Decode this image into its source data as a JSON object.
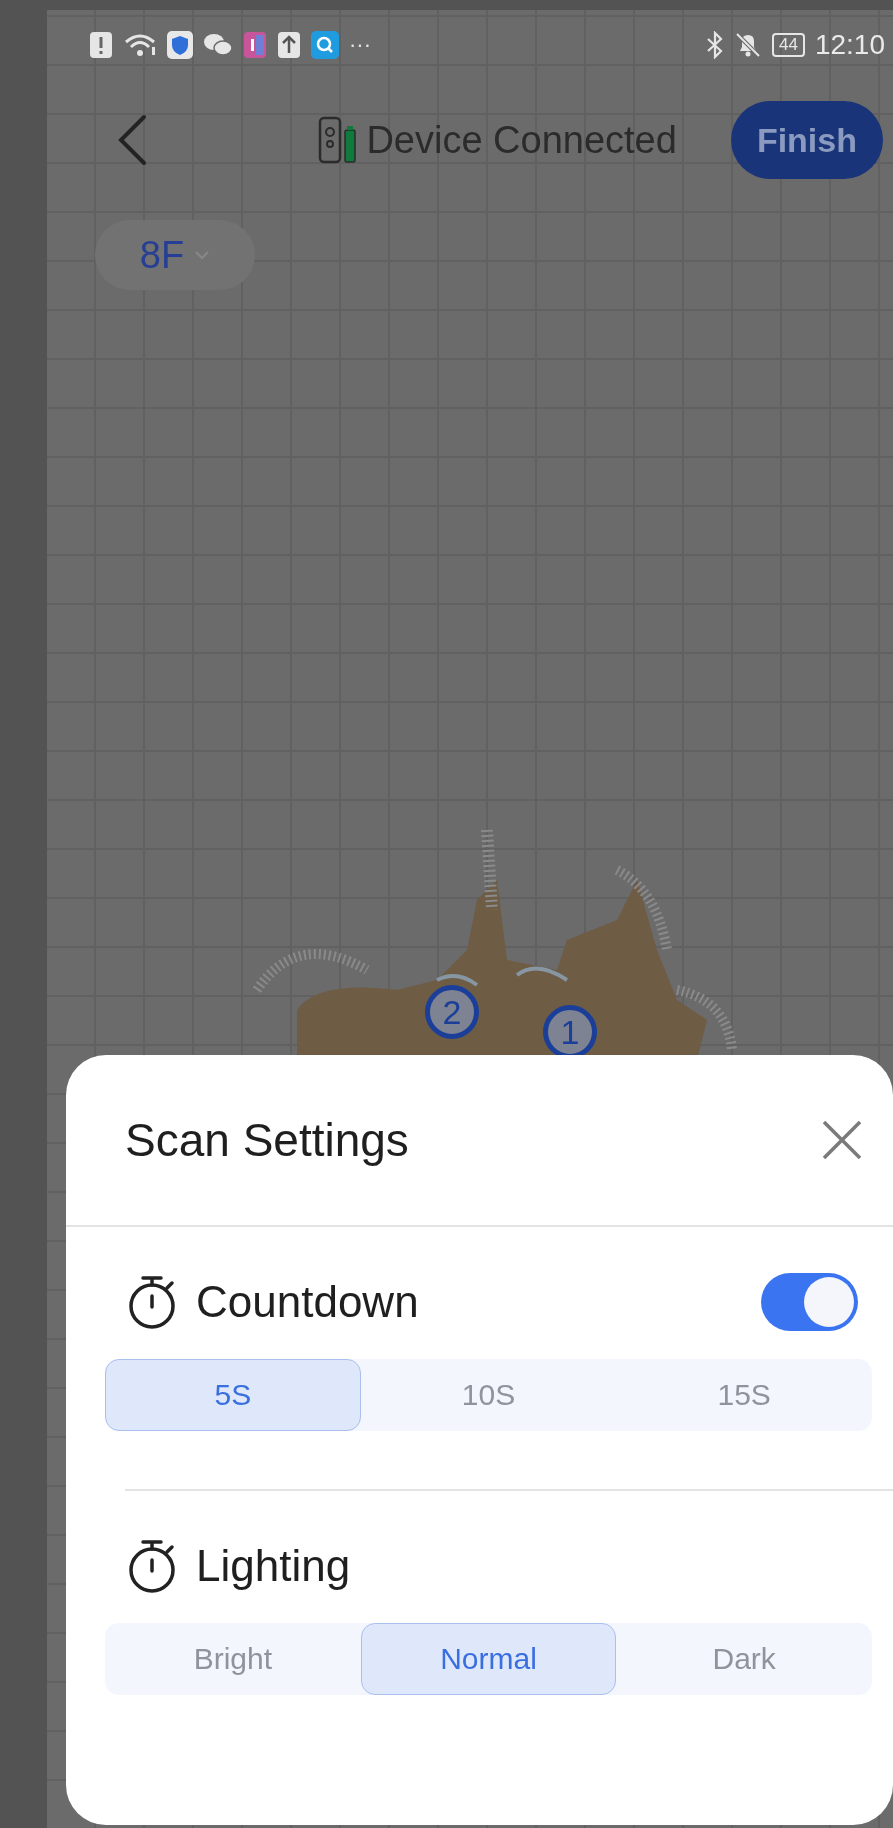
{
  "status_bar": {
    "more": "···",
    "battery": "44",
    "time": "12:10"
  },
  "top_bar": {
    "title": "Device Connected",
    "finish": "Finish"
  },
  "floor_selector": {
    "label": "8F"
  },
  "map": {
    "markers": [
      "2",
      "1"
    ]
  },
  "sheet": {
    "title": "Scan Settings",
    "sections": [
      {
        "label": "Countdown",
        "switch": {
          "on": true
        },
        "options": [
          {
            "label": "5S",
            "selected": true
          },
          {
            "label": "10S",
            "selected": false
          },
          {
            "label": "15S",
            "selected": false
          }
        ]
      },
      {
        "label": "Lighting",
        "options": [
          {
            "label": "Bright",
            "selected": false
          },
          {
            "label": "Normal",
            "selected": true
          },
          {
            "label": "Dark",
            "selected": false
          }
        ]
      }
    ]
  }
}
